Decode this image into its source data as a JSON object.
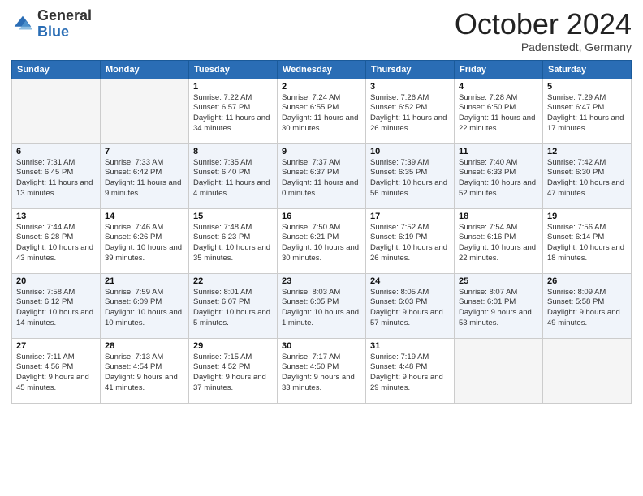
{
  "header": {
    "logo_general": "General",
    "logo_blue": "Blue",
    "month_title": "October 2024",
    "subtitle": "Padenstedt, Germany"
  },
  "weekdays": [
    "Sunday",
    "Monday",
    "Tuesday",
    "Wednesday",
    "Thursday",
    "Friday",
    "Saturday"
  ],
  "weeks": [
    [
      {
        "day": "",
        "empty": true
      },
      {
        "day": "",
        "empty": true
      },
      {
        "day": "1",
        "sunrise": "Sunrise: 7:22 AM",
        "sunset": "Sunset: 6:57 PM",
        "daylight": "Daylight: 11 hours and 34 minutes."
      },
      {
        "day": "2",
        "sunrise": "Sunrise: 7:24 AM",
        "sunset": "Sunset: 6:55 PM",
        "daylight": "Daylight: 11 hours and 30 minutes."
      },
      {
        "day": "3",
        "sunrise": "Sunrise: 7:26 AM",
        "sunset": "Sunset: 6:52 PM",
        "daylight": "Daylight: 11 hours and 26 minutes."
      },
      {
        "day": "4",
        "sunrise": "Sunrise: 7:28 AM",
        "sunset": "Sunset: 6:50 PM",
        "daylight": "Daylight: 11 hours and 22 minutes."
      },
      {
        "day": "5",
        "sunrise": "Sunrise: 7:29 AM",
        "sunset": "Sunset: 6:47 PM",
        "daylight": "Daylight: 11 hours and 17 minutes."
      }
    ],
    [
      {
        "day": "6",
        "sunrise": "Sunrise: 7:31 AM",
        "sunset": "Sunset: 6:45 PM",
        "daylight": "Daylight: 11 hours and 13 minutes."
      },
      {
        "day": "7",
        "sunrise": "Sunrise: 7:33 AM",
        "sunset": "Sunset: 6:42 PM",
        "daylight": "Daylight: 11 hours and 9 minutes."
      },
      {
        "day": "8",
        "sunrise": "Sunrise: 7:35 AM",
        "sunset": "Sunset: 6:40 PM",
        "daylight": "Daylight: 11 hours and 4 minutes."
      },
      {
        "day": "9",
        "sunrise": "Sunrise: 7:37 AM",
        "sunset": "Sunset: 6:37 PM",
        "daylight": "Daylight: 11 hours and 0 minutes."
      },
      {
        "day": "10",
        "sunrise": "Sunrise: 7:39 AM",
        "sunset": "Sunset: 6:35 PM",
        "daylight": "Daylight: 10 hours and 56 minutes."
      },
      {
        "day": "11",
        "sunrise": "Sunrise: 7:40 AM",
        "sunset": "Sunset: 6:33 PM",
        "daylight": "Daylight: 10 hours and 52 minutes."
      },
      {
        "day": "12",
        "sunrise": "Sunrise: 7:42 AM",
        "sunset": "Sunset: 6:30 PM",
        "daylight": "Daylight: 10 hours and 47 minutes."
      }
    ],
    [
      {
        "day": "13",
        "sunrise": "Sunrise: 7:44 AM",
        "sunset": "Sunset: 6:28 PM",
        "daylight": "Daylight: 10 hours and 43 minutes."
      },
      {
        "day": "14",
        "sunrise": "Sunrise: 7:46 AM",
        "sunset": "Sunset: 6:26 PM",
        "daylight": "Daylight: 10 hours and 39 minutes."
      },
      {
        "day": "15",
        "sunrise": "Sunrise: 7:48 AM",
        "sunset": "Sunset: 6:23 PM",
        "daylight": "Daylight: 10 hours and 35 minutes."
      },
      {
        "day": "16",
        "sunrise": "Sunrise: 7:50 AM",
        "sunset": "Sunset: 6:21 PM",
        "daylight": "Daylight: 10 hours and 30 minutes."
      },
      {
        "day": "17",
        "sunrise": "Sunrise: 7:52 AM",
        "sunset": "Sunset: 6:19 PM",
        "daylight": "Daylight: 10 hours and 26 minutes."
      },
      {
        "day": "18",
        "sunrise": "Sunrise: 7:54 AM",
        "sunset": "Sunset: 6:16 PM",
        "daylight": "Daylight: 10 hours and 22 minutes."
      },
      {
        "day": "19",
        "sunrise": "Sunrise: 7:56 AM",
        "sunset": "Sunset: 6:14 PM",
        "daylight": "Daylight: 10 hours and 18 minutes."
      }
    ],
    [
      {
        "day": "20",
        "sunrise": "Sunrise: 7:58 AM",
        "sunset": "Sunset: 6:12 PM",
        "daylight": "Daylight: 10 hours and 14 minutes."
      },
      {
        "day": "21",
        "sunrise": "Sunrise: 7:59 AM",
        "sunset": "Sunset: 6:09 PM",
        "daylight": "Daylight: 10 hours and 10 minutes."
      },
      {
        "day": "22",
        "sunrise": "Sunrise: 8:01 AM",
        "sunset": "Sunset: 6:07 PM",
        "daylight": "Daylight: 10 hours and 5 minutes."
      },
      {
        "day": "23",
        "sunrise": "Sunrise: 8:03 AM",
        "sunset": "Sunset: 6:05 PM",
        "daylight": "Daylight: 10 hours and 1 minute."
      },
      {
        "day": "24",
        "sunrise": "Sunrise: 8:05 AM",
        "sunset": "Sunset: 6:03 PM",
        "daylight": "Daylight: 9 hours and 57 minutes."
      },
      {
        "day": "25",
        "sunrise": "Sunrise: 8:07 AM",
        "sunset": "Sunset: 6:01 PM",
        "daylight": "Daylight: 9 hours and 53 minutes."
      },
      {
        "day": "26",
        "sunrise": "Sunrise: 8:09 AM",
        "sunset": "Sunset: 5:58 PM",
        "daylight": "Daylight: 9 hours and 49 minutes."
      }
    ],
    [
      {
        "day": "27",
        "sunrise": "Sunrise: 7:11 AM",
        "sunset": "Sunset: 4:56 PM",
        "daylight": "Daylight: 9 hours and 45 minutes."
      },
      {
        "day": "28",
        "sunrise": "Sunrise: 7:13 AM",
        "sunset": "Sunset: 4:54 PM",
        "daylight": "Daylight: 9 hours and 41 minutes."
      },
      {
        "day": "29",
        "sunrise": "Sunrise: 7:15 AM",
        "sunset": "Sunset: 4:52 PM",
        "daylight": "Daylight: 9 hours and 37 minutes."
      },
      {
        "day": "30",
        "sunrise": "Sunrise: 7:17 AM",
        "sunset": "Sunset: 4:50 PM",
        "daylight": "Daylight: 9 hours and 33 minutes."
      },
      {
        "day": "31",
        "sunrise": "Sunrise: 7:19 AM",
        "sunset": "Sunset: 4:48 PM",
        "daylight": "Daylight: 9 hours and 29 minutes."
      },
      {
        "day": "",
        "empty": true
      },
      {
        "day": "",
        "empty": true
      }
    ]
  ]
}
